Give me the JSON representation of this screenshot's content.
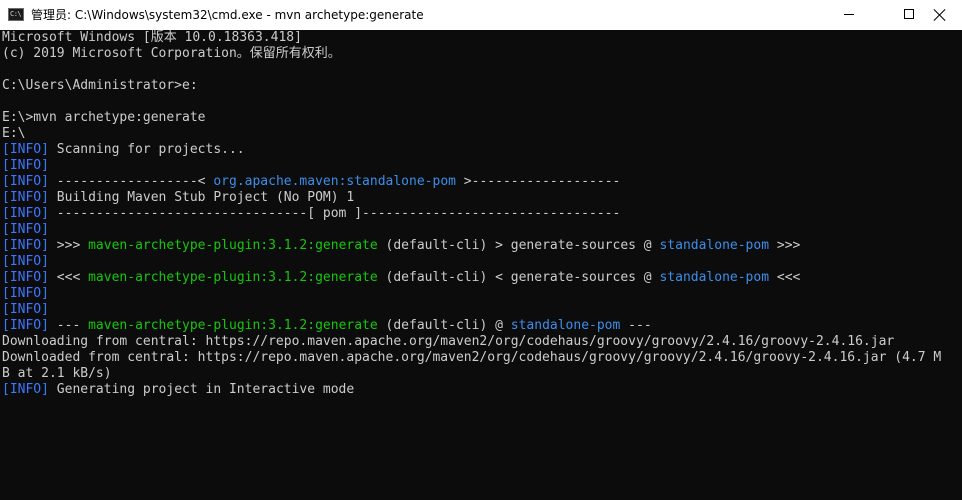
{
  "titlebar": {
    "icon_label": "C:\\",
    "title": "管理员: C:\\Windows\\system32\\cmd.exe - mvn  archetype:generate"
  },
  "console": {
    "lines": [
      {
        "segments": [
          {
            "text": "Microsoft Windows [版本 10.0.18363.418]",
            "style": "plain"
          }
        ]
      },
      {
        "segments": [
          {
            "text": "(c) 2019 Microsoft Corporation。保留所有权利。",
            "style": "plain"
          }
        ]
      },
      {
        "segments": []
      },
      {
        "segments": [
          {
            "text": "C:\\Users\\Administrator>e:",
            "style": "plain"
          }
        ]
      },
      {
        "segments": []
      },
      {
        "segments": [
          {
            "text": "E:\\>mvn archetype:generate",
            "style": "plain"
          }
        ]
      },
      {
        "segments": [
          {
            "text": "E:\\",
            "style": "plain"
          }
        ]
      },
      {
        "segments": [
          {
            "text": "[INFO]",
            "style": "tag"
          },
          {
            "text": " Scanning for projects...",
            "style": "plain"
          }
        ]
      },
      {
        "segments": [
          {
            "text": "[INFO]",
            "style": "tag"
          }
        ]
      },
      {
        "segments": [
          {
            "text": "[INFO]",
            "style": "tag"
          },
          {
            "text": " ------------------< ",
            "style": "plain"
          },
          {
            "text": "org.apache.maven:standalone-pom",
            "style": "cyan"
          },
          {
            "text": " >-------------------",
            "style": "plain"
          }
        ]
      },
      {
        "segments": [
          {
            "text": "[INFO]",
            "style": "tag"
          },
          {
            "text": " Building Maven Stub Project (No POM) 1",
            "style": "plain"
          }
        ]
      },
      {
        "segments": [
          {
            "text": "[INFO]",
            "style": "tag"
          },
          {
            "text": " --------------------------------[ pom ]---------------------------------",
            "style": "plain"
          }
        ]
      },
      {
        "segments": [
          {
            "text": "[INFO]",
            "style": "tag"
          }
        ]
      },
      {
        "segments": [
          {
            "text": "[INFO]",
            "style": "tag"
          },
          {
            "text": " >>> ",
            "style": "plain"
          },
          {
            "text": "maven-archetype-plugin:3.1.2:generate",
            "style": "green"
          },
          {
            "text": " (default-cli) > generate-sources @ ",
            "style": "plain"
          },
          {
            "text": "standalone-pom",
            "style": "cyan"
          },
          {
            "text": " >>>",
            "style": "plain"
          }
        ]
      },
      {
        "segments": [
          {
            "text": "[INFO]",
            "style": "tag"
          }
        ]
      },
      {
        "segments": [
          {
            "text": "[INFO]",
            "style": "tag"
          },
          {
            "text": " <<< ",
            "style": "plain"
          },
          {
            "text": "maven-archetype-plugin:3.1.2:generate",
            "style": "green"
          },
          {
            "text": " (default-cli) < generate-sources @ ",
            "style": "plain"
          },
          {
            "text": "standalone-pom",
            "style": "cyan"
          },
          {
            "text": " <<<",
            "style": "plain"
          }
        ]
      },
      {
        "segments": [
          {
            "text": "[INFO]",
            "style": "tag"
          }
        ]
      },
      {
        "segments": [
          {
            "text": "[INFO]",
            "style": "tag"
          }
        ]
      },
      {
        "segments": [
          {
            "text": "[INFO]",
            "style": "tag"
          },
          {
            "text": " --- ",
            "style": "plain"
          },
          {
            "text": "maven-archetype-plugin:3.1.2:generate",
            "style": "green"
          },
          {
            "text": " (default-cli) @ ",
            "style": "plain"
          },
          {
            "text": "standalone-pom",
            "style": "cyan"
          },
          {
            "text": " ---",
            "style": "plain"
          }
        ]
      },
      {
        "segments": [
          {
            "text": "Downloading from central: https://repo.maven.apache.org/maven2/org/codehaus/groovy/groovy/2.4.16/groovy-2.4.16.jar",
            "style": "plain"
          }
        ]
      },
      {
        "segments": [
          {
            "text": "Downloaded from central: https://repo.maven.apache.org/maven2/org/codehaus/groovy/groovy/2.4.16/groovy-2.4.16.jar (4.7 M",
            "style": "plain"
          }
        ]
      },
      {
        "segments": [
          {
            "text": "B at 2.1 kB/s)",
            "style": "plain"
          }
        ]
      },
      {
        "segments": [
          {
            "text": "[INFO]",
            "style": "tag"
          },
          {
            "text": " Generating project in Interactive mode",
            "style": "plain"
          }
        ]
      }
    ]
  },
  "colors": {
    "console_background": "#0c0c0c",
    "console_text": "#cccccc",
    "info_tag": "#3b78ff",
    "plugin_green": "#16c60c",
    "project_cyan": "#3b8eea",
    "titlebar_background": "#ffffff"
  },
  "icons": {
    "app": "console-icon",
    "minimize": "minimize-icon",
    "maximize": "maximize-icon",
    "close": "close-icon"
  }
}
